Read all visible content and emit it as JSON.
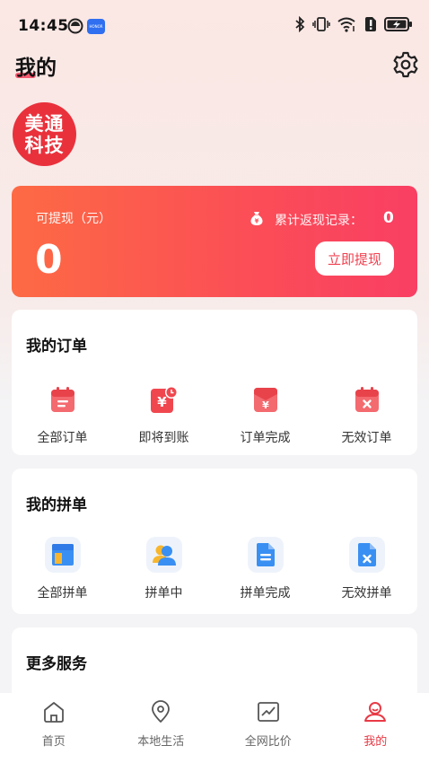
{
  "status_bar": {
    "time": "14:45",
    "notification_badge": "HONOR"
  },
  "header": {
    "title": "我的",
    "settings_icon": "gear-icon"
  },
  "brand": {
    "logo_line1": "美通",
    "logo_line2": "科技",
    "logo_color": "#e9313c"
  },
  "earnings": {
    "withdrawable_label": "可提现（元）",
    "withdrawable_amount": "0",
    "record_label": "累计返现记录：",
    "record_value": "0",
    "withdraw_button": "立即提现",
    "gradient_start": "#fd6a44",
    "gradient_end": "#f93f63"
  },
  "orders": {
    "title": "我的订单",
    "items": [
      {
        "label": "全部订单",
        "icon": "order-list-icon"
      },
      {
        "label": "即将到账",
        "icon": "pending-payment-icon"
      },
      {
        "label": "订单完成",
        "icon": "order-complete-icon"
      },
      {
        "label": "无效订单",
        "icon": "invalid-order-icon"
      }
    ]
  },
  "group_orders": {
    "title": "我的拼单",
    "items": [
      {
        "label": "全部拼单",
        "icon": "group-all-icon"
      },
      {
        "label": "拼单中",
        "icon": "group-in-progress-icon"
      },
      {
        "label": "拼单完成",
        "icon": "group-complete-icon"
      },
      {
        "label": "无效拼单",
        "icon": "group-invalid-icon"
      }
    ]
  },
  "more_services": {
    "title": "更多服务"
  },
  "tabbar": {
    "active_color": "#e83a45",
    "items": [
      {
        "label": "首页",
        "icon": "home-icon"
      },
      {
        "label": "本地生活",
        "icon": "location-icon"
      },
      {
        "label": "全网比价",
        "icon": "price-chart-icon"
      },
      {
        "label": "我的",
        "icon": "profile-icon",
        "active": true
      }
    ]
  }
}
